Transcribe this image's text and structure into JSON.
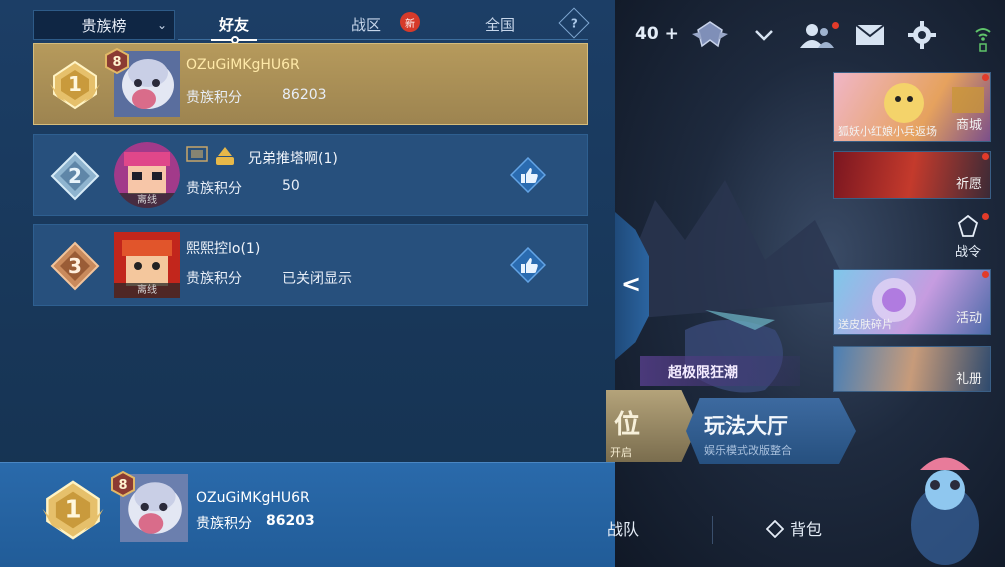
{
  "topbar": {
    "rank_select": "贵族榜",
    "tabs": [
      "好友",
      "战区",
      "全国"
    ],
    "new_badge": "新"
  },
  "rows": [
    {
      "rank": "1",
      "level": "8",
      "name": "OZuGiMKgHU6R",
      "score_label": "贵族积分",
      "score": "86203",
      "offline": ""
    },
    {
      "rank": "2",
      "name": "兄弟推塔啊(1)",
      "score_label": "贵族积分",
      "score": "50",
      "offline": "离线"
    },
    {
      "rank": "3",
      "name": "熙熙控lo(1)",
      "score_label": "贵族积分",
      "score": "已关闭显示",
      "offline": "离线"
    }
  ],
  "self": {
    "rank": "1",
    "level": "8",
    "name": "OZuGiMKgHU6R",
    "score_label": "贵族积分",
    "score": "86203"
  },
  "lobby": {
    "stamina": "40",
    "cards": [
      {
        "caption": "狐妖小红娘小兵返场",
        "label": "商城"
      },
      {
        "caption": "",
        "label": "祈愿"
      },
      {
        "caption": "送皮肤碎片",
        "label": "活动"
      },
      {
        "caption": "",
        "label": "礼册"
      }
    ],
    "war_order": "战令",
    "promo": "超极限狂潮",
    "rank_button": {
      "title": "位",
      "subtitle": "开启"
    },
    "mode_hall": {
      "title": "玩法大厅",
      "subtitle": "娱乐模式改版整合"
    },
    "team": "战队",
    "bag": "背包"
  },
  "colors": {
    "gold_row": "#b69a5c",
    "panel": "#1c3e66",
    "row": "#27507d",
    "self_bar": "#2a6aab",
    "red_dot": "#e23b2a"
  }
}
